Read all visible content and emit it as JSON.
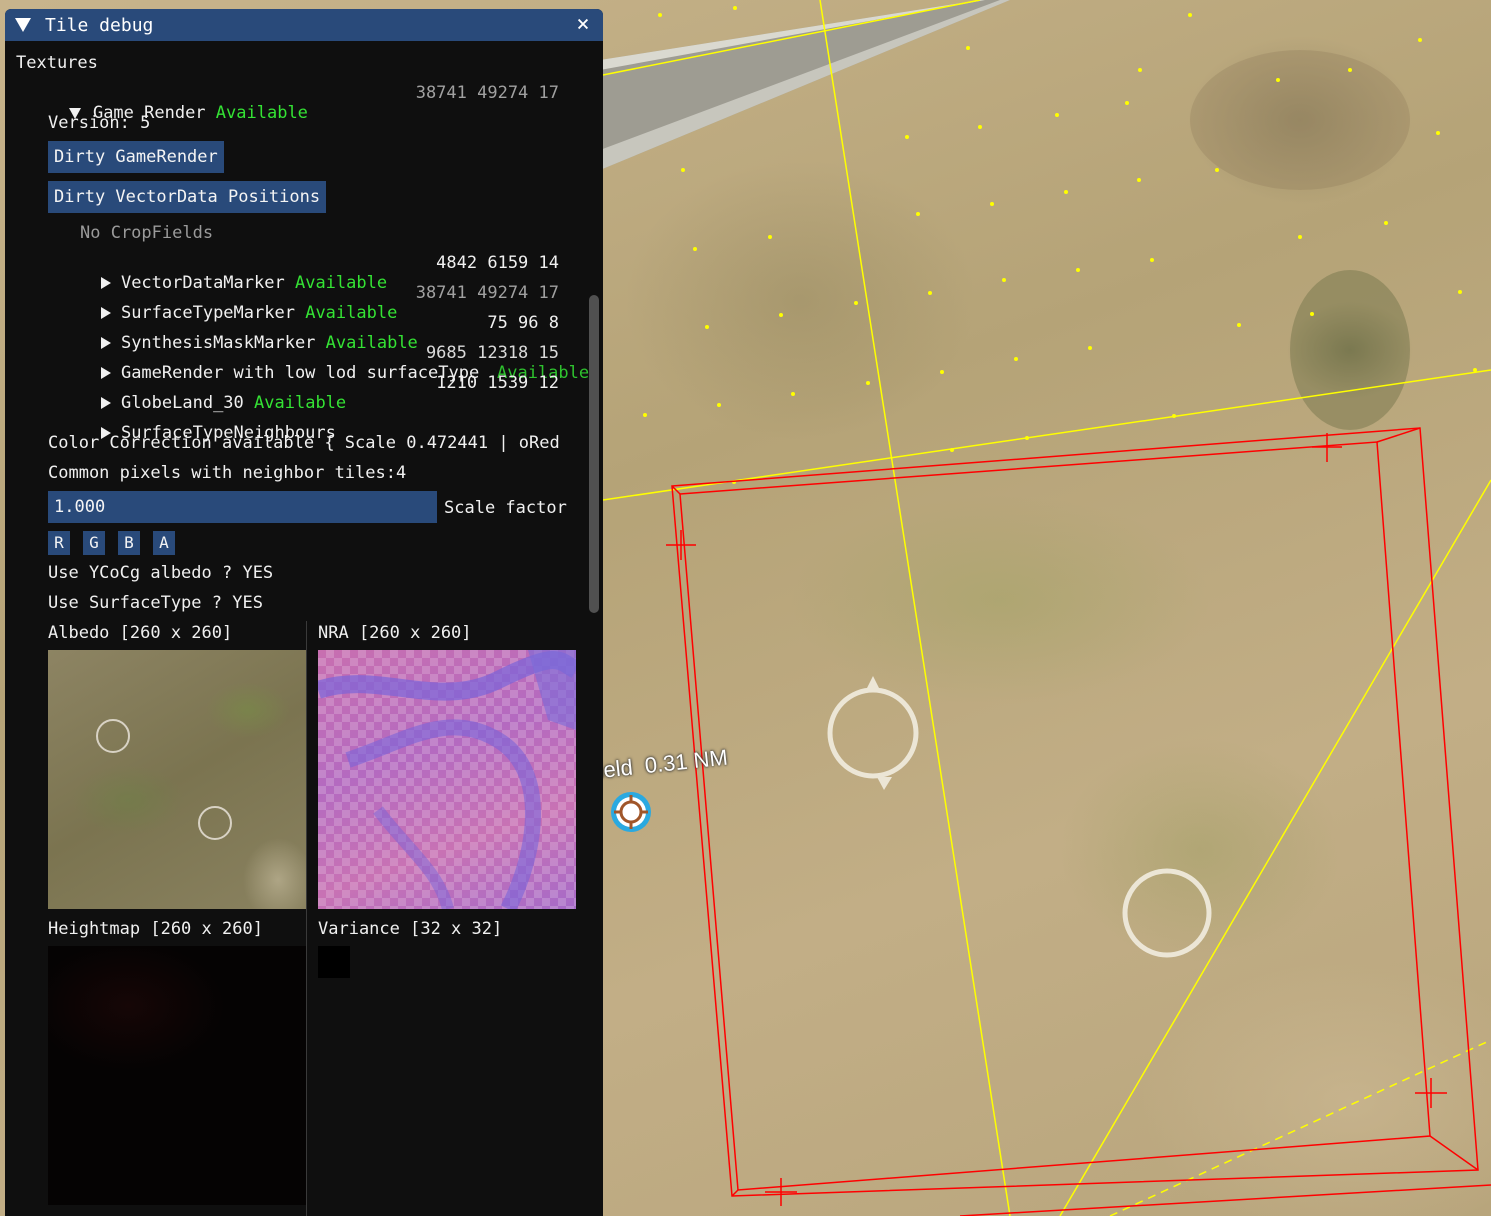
{
  "window": {
    "title": "Tile debug",
    "close_symbol": "×"
  },
  "textures_header": "Textures",
  "game_render": {
    "label": "Game Render",
    "status": "Available",
    "coords": "38741 49274 17",
    "version": "Version: 5",
    "dirty_gamerender_button": "Dirty GameRender",
    "dirty_vectordata_button": "Dirty VectorData Positions",
    "no_cropfields": "No CropFields"
  },
  "children": [
    {
      "label": "VectorDataMarker",
      "status": "Available",
      "coords": "4842 6159 14"
    },
    {
      "label": "SurfaceTypeMarker",
      "status": "Available",
      "coords": "38741 49274 17"
    },
    {
      "label": "SynthesisMaskMarker",
      "status": "Available",
      "coords": "75 96 8"
    },
    {
      "label": "GameRender with low lod surfaceType",
      "status": "Available",
      "coords": "9685 12318 15"
    },
    {
      "label": "GlobeLand_30",
      "status": "Available",
      "coords": "1210 1539 12"
    },
    {
      "label": "SurfaceTypeNeighbours",
      "status": "",
      "coords": ""
    }
  ],
  "color_correction": "Color Correction available { Scale 0.472441 | oRed",
  "common_pixels": "Common pixels with neighbor tiles:4",
  "scale_factor": {
    "value": "1.000",
    "label": "Scale factor"
  },
  "channels": [
    "R",
    "G",
    "B",
    "A"
  ],
  "ycocg": "Use YCoCg albedo ? YES",
  "surface_type": "Use SurfaceType ? YES",
  "textures": {
    "albedo": "Albedo [260 x 260]",
    "nra": "NRA [260 x 260]",
    "heightmap": "Heightmap [260 x 260]",
    "variance": "Variance [32 x 32]"
  },
  "map": {
    "label_prefix": "ield",
    "distance": "0.31 NM"
  },
  "colors": {
    "panel_bg": "#0f0f0f",
    "title_bg": "#294a7a",
    "button_bg": "#294a7a",
    "available_green": "#34e234",
    "red_lines": "#ff0000",
    "yellow_lines": "#ffff00"
  }
}
